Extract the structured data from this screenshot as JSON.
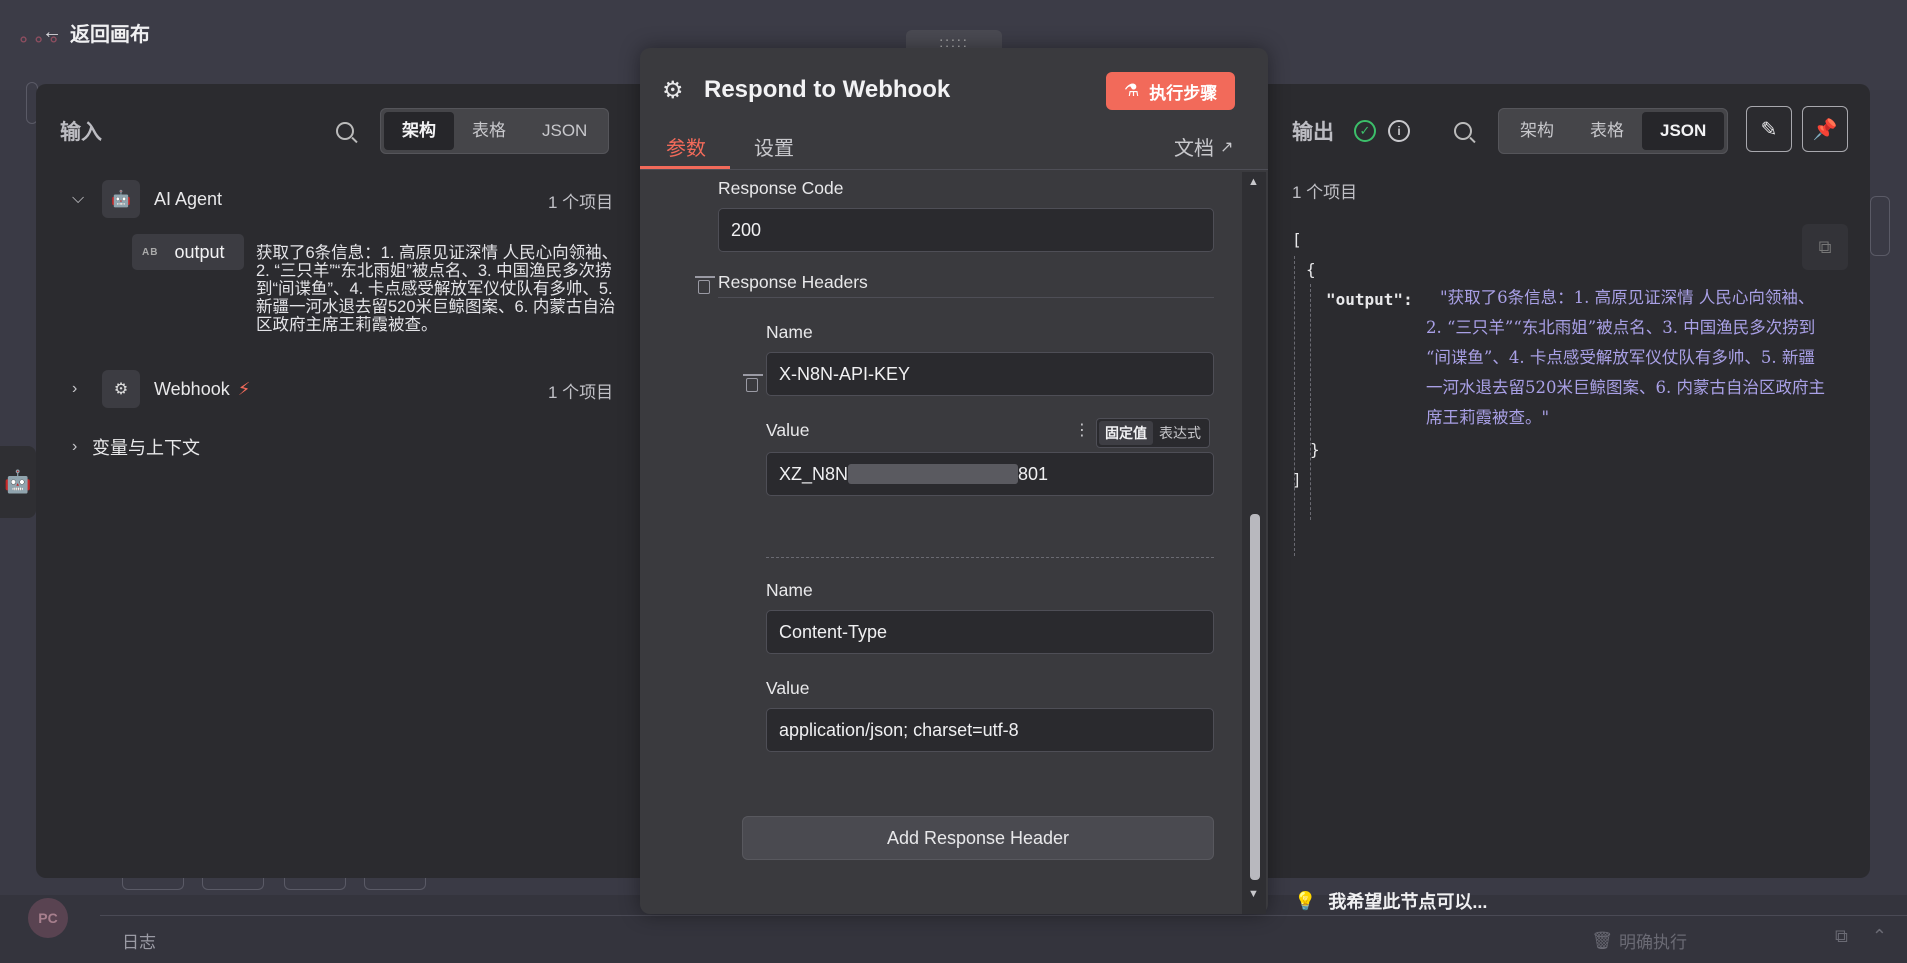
{
  "canvas": {
    "back_label": "返回画布",
    "logs_label": "日志",
    "avatar_initials": "PC",
    "clear_execution_label": "明确执行"
  },
  "input_panel": {
    "title": "输入",
    "view_tabs": [
      "架构",
      "表格",
      "JSON"
    ],
    "active_view": "架构",
    "nodes": [
      {
        "name": "AI Agent",
        "count": "1 个项目",
        "expanded": true,
        "field": {
          "type_badge": "AB",
          "name": "output",
          "value": "获取了6条信息：1. 高原见证深情 人民心向领袖、2. “三只羊”“东北雨姐”被点名、3. 中国渔民多次捞到“间谍鱼”、4. 卡点感受解放军仪仗队有多帅、5. 新疆一河水退去留520米巨鲸图案、6. 内蒙古自治区政府主席王莉霞被查。"
        }
      },
      {
        "name": "Webhook",
        "count": "1 个项目",
        "expanded": false
      }
    ],
    "variables_label": "变量与上下文"
  },
  "node_editor": {
    "title": "Respond to Webhook",
    "execute_button": "执行步骤",
    "tabs": [
      "参数",
      "设置"
    ],
    "active_tab": "参数",
    "docs_label": "文档",
    "response_code_label": "Response Code",
    "response_code_value": "200",
    "response_headers_label": "Response Headers",
    "headers": [
      {
        "name_label": "Name",
        "name_value": "X-N8N-API-KEY",
        "value_label": "Value",
        "value_mode_options": [
          "固定值",
          "表达式"
        ],
        "value_mode_active": "固定值",
        "value_start": "XZ_N8N",
        "value_end": "801"
      },
      {
        "name_label": "Name",
        "name_value": "Content-Type",
        "value_label": "Value",
        "value_value": "application/json; charset=utf-8"
      }
    ],
    "add_header_button": "Add Response Header"
  },
  "output_panel": {
    "title": "输出",
    "view_tabs": [
      "架构",
      "表格",
      "JSON"
    ],
    "active_view": "JSON",
    "count": "1 个项目",
    "json": {
      "open_bracket": "[",
      "open_brace": "{",
      "key": "\"output\":",
      "value_lines": [
        "\"获取了6条信息：1. 高原见证深情 人民心向领袖、",
        "2. “三只羊”“东北雨姐”被点名、3. 中国渔民多次捞到",
        "“间谍鱼”、4. 卡点感受解放军仪仗队有多帅、5. 新疆",
        "一河水退去留520米巨鲸图案、6. 内蒙古自治区政府主",
        "席王莉霞被查。\""
      ],
      "close_brace": "}",
      "close_bracket": "]"
    },
    "hint_label": "我希望此节点可以..."
  },
  "colors": {
    "accent": "#f26a5a",
    "success": "#3cbf6a",
    "json_string": "#a9a0e6"
  }
}
